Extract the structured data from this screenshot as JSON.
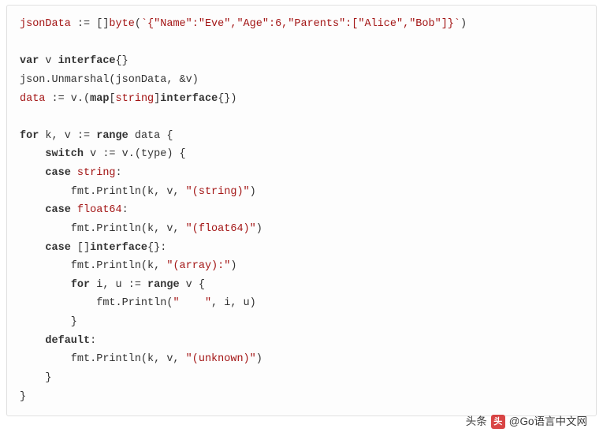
{
  "code": {
    "l1a": "jsonData",
    "l1b": " := []",
    "l1c": "byte",
    "l1d": "(",
    "l1e": "`{\"Name\":\"Eve\",\"Age\":6,\"Parents\":[\"Alice\",\"Bob\"]}`",
    "l1f": ")",
    "l3a": "var",
    "l3b": " v ",
    "l3c": "interface",
    "l3d": "{}",
    "l4": "json.Unmarshal(jsonData, &v)",
    "l5a": "data",
    "l5b": " := v.(",
    "l5c": "map",
    "l5d": "[",
    "l5e": "string",
    "l5f": "]",
    "l5g": "interface",
    "l5h": "{})",
    "l7a": "for",
    "l7b": " k, v := ",
    "l7c": "range",
    "l7d": " data {",
    "l8a": "    ",
    "l8b": "switch",
    "l8c": " v := v.(type) {",
    "l9a": "    ",
    "l9b": "case",
    "l9c": " ",
    "l9d": "string",
    "l9e": ":",
    "l10a": "        fmt.Println(k, v, ",
    "l10b": "\"(string)\"",
    "l10c": ")",
    "l11a": "    ",
    "l11b": "case",
    "l11c": " ",
    "l11d": "float64",
    "l11e": ":",
    "l12a": "        fmt.Println(k, v, ",
    "l12b": "\"(float64)\"",
    "l12c": ")",
    "l13a": "    ",
    "l13b": "case",
    "l13c": " []",
    "l13d": "interface",
    "l13e": "{}:",
    "l14a": "        fmt.Println(k, ",
    "l14b": "\"(array):\"",
    "l14c": ")",
    "l15a": "        ",
    "l15b": "for",
    "l15c": " i, u := ",
    "l15d": "range",
    "l15e": " v {",
    "l16a": "            fmt.Println(",
    "l16b": "\"    \"",
    "l16c": ", i, u)",
    "l17": "        }",
    "l18a": "    ",
    "l18b": "default",
    "l18c": ":",
    "l19a": "        fmt.Println(k, v, ",
    "l19b": "\"(unknown)\"",
    "l19c": ")",
    "l20": "    }",
    "l21": "}"
  },
  "watermark": {
    "prefix": "头条",
    "handle": "@Go语言中文网"
  }
}
